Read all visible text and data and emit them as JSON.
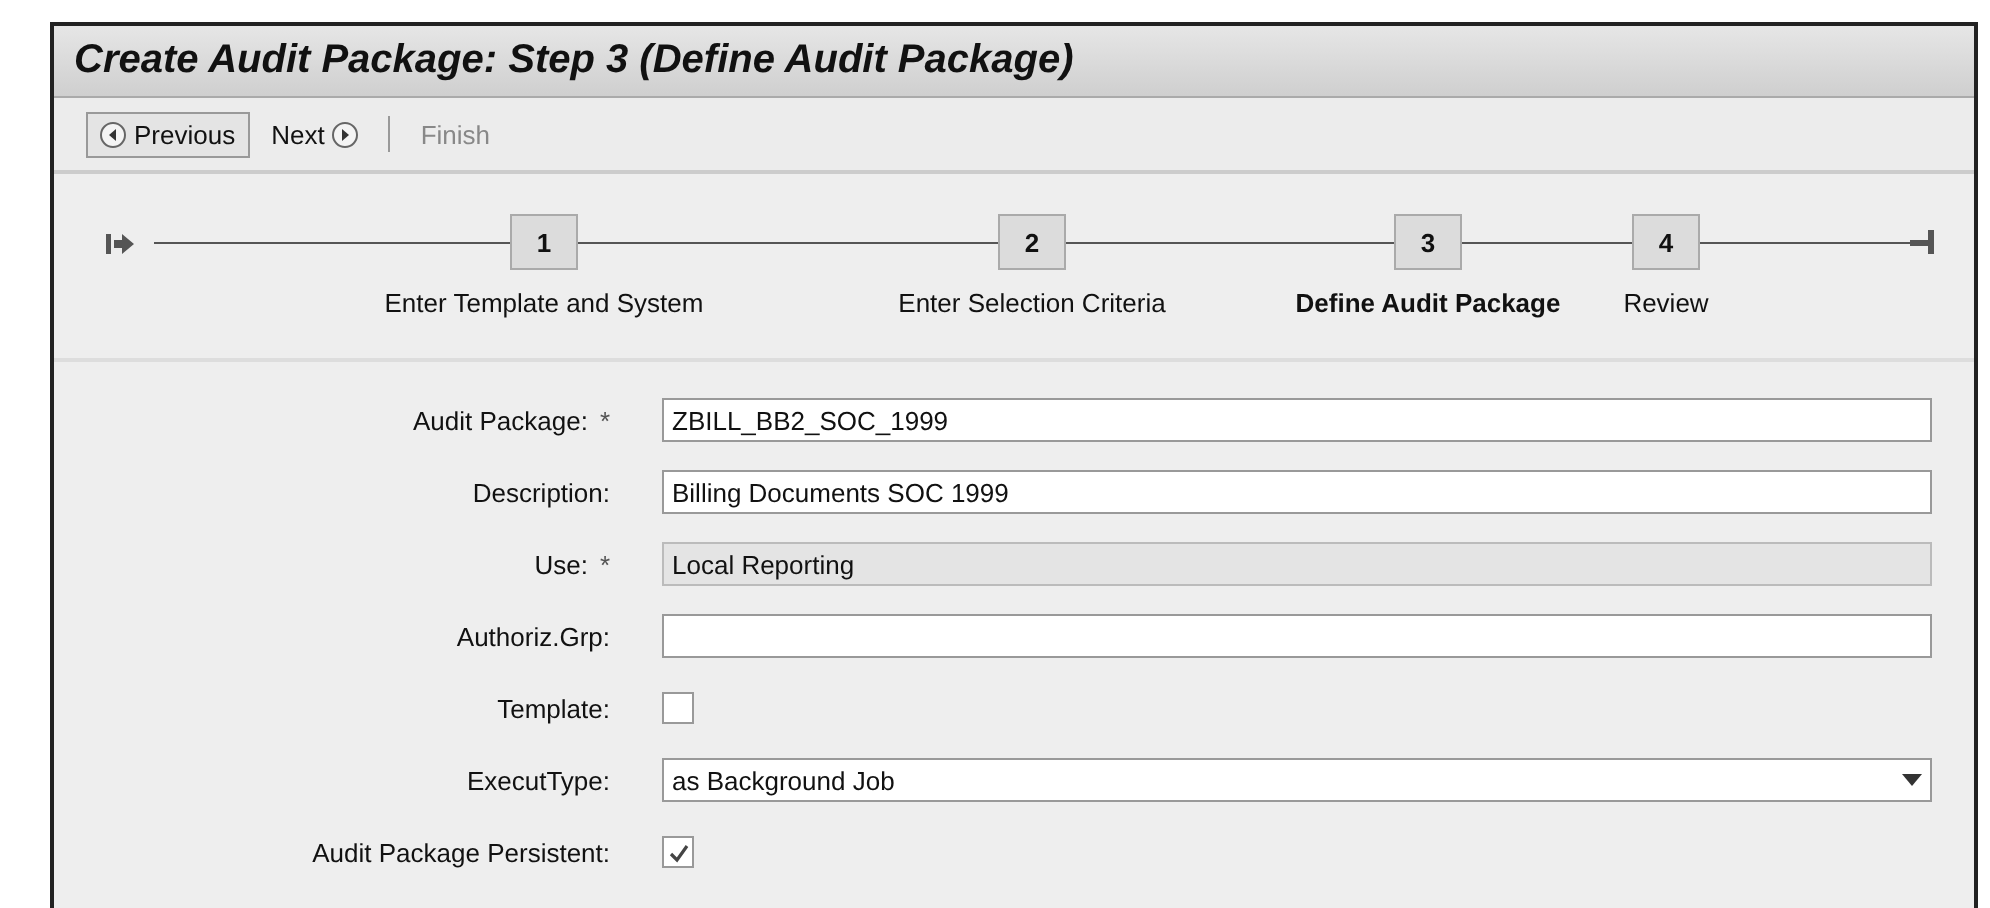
{
  "window": {
    "title": "Create Audit Package: Step 3 (Define Audit Package)"
  },
  "toolbar": [
    {
      "kind": "prev",
      "label": "Previous",
      "disabled": false
    },
    {
      "kind": "next",
      "label": "Next",
      "disabled": false
    },
    {
      "kind": "plain",
      "label": "Finish",
      "disabled": true
    }
  ],
  "steps": [
    {
      "number": "1",
      "label": "Enter Template and System",
      "selected": false
    },
    {
      "number": "2",
      "label": "Enter Selection Criteria",
      "selected": false
    },
    {
      "number": "3",
      "label": "Define Audit Package",
      "selected": true
    },
    {
      "number": "4",
      "label": "Review",
      "selected": false
    }
  ],
  "fields": [
    {
      "kind": "text",
      "label": "Audit Package:",
      "required_mark": "*",
      "value": "ZBILL_BB2_SOC_1999"
    },
    {
      "kind": "text",
      "label": "Description:",
      "value": "Billing Documents SOC 1999"
    },
    {
      "kind": "readonly",
      "label": "Use:",
      "required_mark": "*",
      "value": "Local Reporting"
    },
    {
      "kind": "text",
      "label": "Authoriz.Grp:"
    },
    {
      "kind": "checkbox",
      "label": "Template:",
      "checked": false
    },
    {
      "kind": "dropdown",
      "label": "ExecutType:",
      "value": "as Background Job"
    },
    {
      "kind": "checkbox",
      "label": "Audit Package Persistent:",
      "checked": true
    }
  ]
}
